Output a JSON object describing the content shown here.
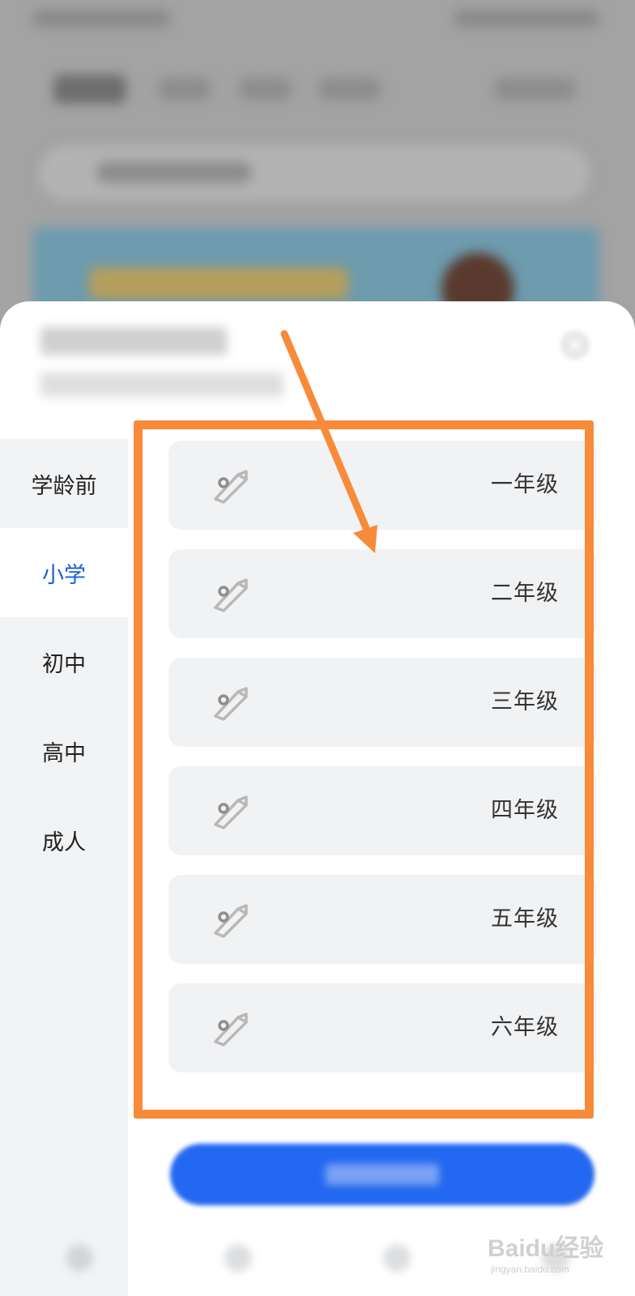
{
  "colors": {
    "accent": "#1a5fd6",
    "button": "#2368f0",
    "annotation": "#f78b3a",
    "card": "#f1f2f4",
    "sidebar": "#f2f3f5"
  },
  "sheet": {
    "close_icon": "close-icon"
  },
  "categories": {
    "items": [
      {
        "label": "学龄前",
        "active": false
      },
      {
        "label": "小学",
        "active": true
      },
      {
        "label": "初中",
        "active": false
      },
      {
        "label": "高中",
        "active": false
      },
      {
        "label": "成人",
        "active": false
      }
    ]
  },
  "grades": {
    "icon": "pencil-icon",
    "items": [
      {
        "label": "一年级"
      },
      {
        "label": "二年级"
      },
      {
        "label": "三年级"
      },
      {
        "label": "四年级"
      },
      {
        "label": "五年级"
      },
      {
        "label": "六年级"
      }
    ]
  },
  "watermark": {
    "main": "Baidu经验",
    "sub": "jingyan.baidu.com"
  }
}
